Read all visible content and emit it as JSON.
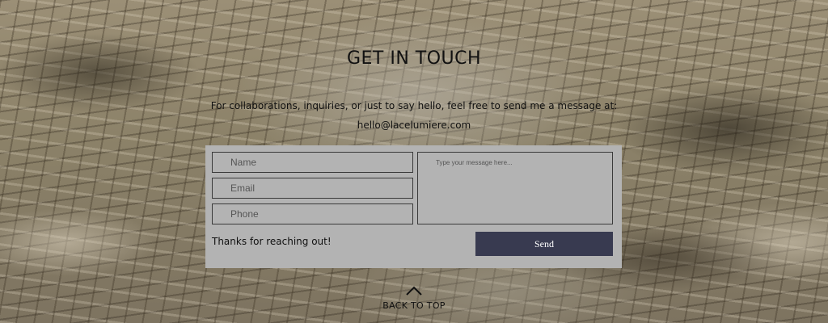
{
  "contact": {
    "heading": "GET IN TOUCH",
    "intro": "For collaborations, inquiries, or just to say hello, feel free to send me a message at:",
    "email": "hello@lacelumiere.com"
  },
  "form": {
    "name_placeholder": "Name",
    "email_placeholder": "Email",
    "phone_placeholder": "Phone",
    "message_placeholder": "Type your message here...",
    "thanks_text": "Thanks for reaching out!",
    "send_label": "Send",
    "send_color": "#383a50",
    "form_background": "#b3b3b3"
  },
  "footer": {
    "back_to_top_label": "BACK TO TOP",
    "back_to_top_icon": "chevron-up-icon"
  }
}
